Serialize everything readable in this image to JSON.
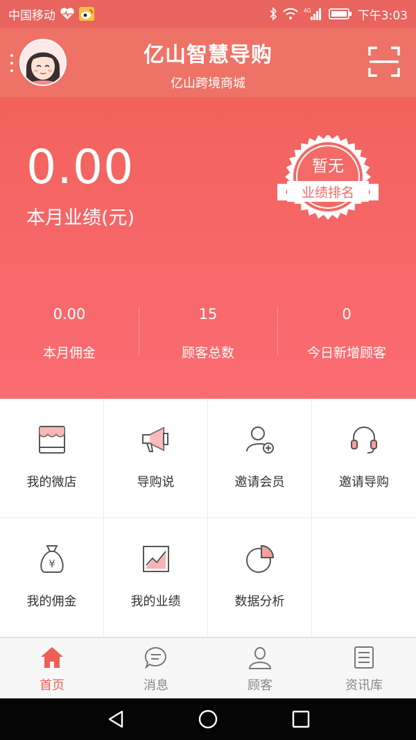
{
  "status_bar": {
    "carrier": "中国移动",
    "network": "4G",
    "time": "下午3:03"
  },
  "header": {
    "title": "亿山智慧导购",
    "subtitle": "亿山跨境商城"
  },
  "hero": {
    "performance_value": "0.00",
    "performance_label": "本月业绩(元)",
    "badge_top": "暂无",
    "badge_ribbon": "业绩排名",
    "stats": [
      {
        "value": "0.00",
        "label": "本月佣金"
      },
      {
        "value": "15",
        "label": "顾客总数"
      },
      {
        "value": "0",
        "label": "今日新增顾客"
      }
    ]
  },
  "grid": {
    "items": [
      {
        "label": "我的微店",
        "icon": "shop-icon"
      },
      {
        "label": "导购说",
        "icon": "megaphone-icon"
      },
      {
        "label": "邀请会员",
        "icon": "add-member-icon"
      },
      {
        "label": "邀请导购",
        "icon": "headset-icon"
      },
      {
        "label": "我的佣金",
        "icon": "money-bag-icon"
      },
      {
        "label": "我的业绩",
        "icon": "trend-chart-icon"
      },
      {
        "label": "数据分析",
        "icon": "pie-chart-icon"
      }
    ]
  },
  "tabbar": {
    "tabs": [
      {
        "label": "首页",
        "icon": "home-icon",
        "active": true
      },
      {
        "label": "消息",
        "icon": "message-icon",
        "active": false
      },
      {
        "label": "顾客",
        "icon": "customer-icon",
        "active": false
      },
      {
        "label": "资讯库",
        "icon": "news-icon",
        "active": false
      }
    ]
  },
  "colors": {
    "primary": "#f2625c",
    "header": "#ef7266",
    "active_tab": "#ef5e58",
    "icon_accent": "#f5a0a0"
  }
}
